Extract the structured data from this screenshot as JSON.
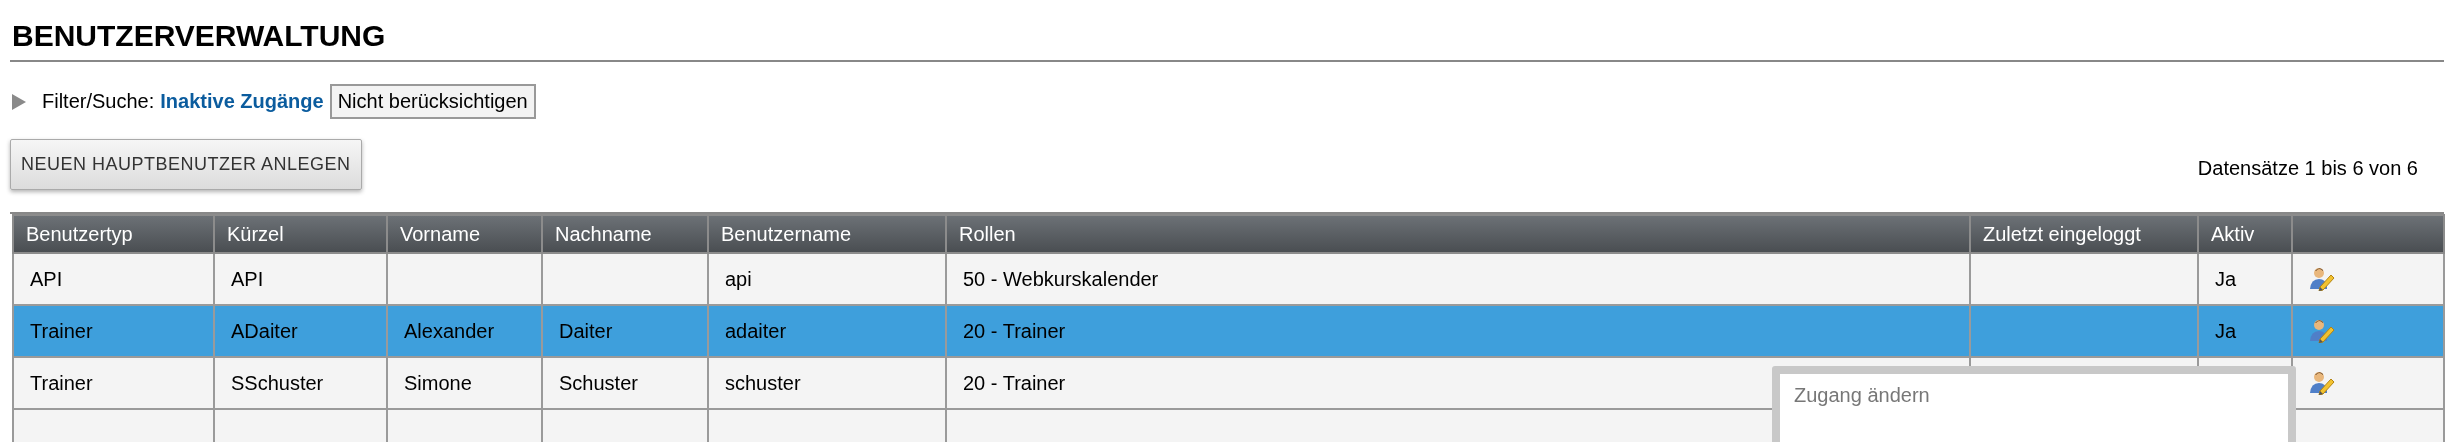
{
  "page_title": "BENUTZERVERWALTUNG",
  "filter": {
    "label": "Filter/Suche:",
    "link": "Inaktive Zugänge",
    "button": "Nicht berücksichtigen"
  },
  "new_button": "NEUEN HAUPTBENUTZER ANLEGEN",
  "record_count": "Datensätze 1 bis 6 von 6",
  "table": {
    "columns": [
      "Benutzertyp",
      "Kürzel",
      "Vorname",
      "Nachname",
      "Benutzername",
      "Rollen",
      "Zuletzt eingeloggt",
      "Aktiv"
    ],
    "rows": [
      {
        "selected": false,
        "benutzertyp": "API",
        "kuerzel": "API",
        "benutzername": "api",
        "rollen": "50 - Webkurskalender",
        "aktiv": "Ja"
      },
      {
        "selected": true,
        "benutzertyp": "Trainer",
        "kuerzel": "ADaiter",
        "vorname": "Alexander",
        "nachname": "Daiter",
        "benutzername": "adaiter",
        "rollen": "20 - Trainer",
        "aktiv": "Ja"
      },
      {
        "selected": false,
        "benutzertyp": "Trainer",
        "kuerzel": "SSchuster",
        "vorname": "Simone",
        "nachname": "Schuster",
        "benutzername": "schuster",
        "rollen": "20 - Trainer"
      }
    ]
  },
  "tooltip": "Zugang ändern"
}
